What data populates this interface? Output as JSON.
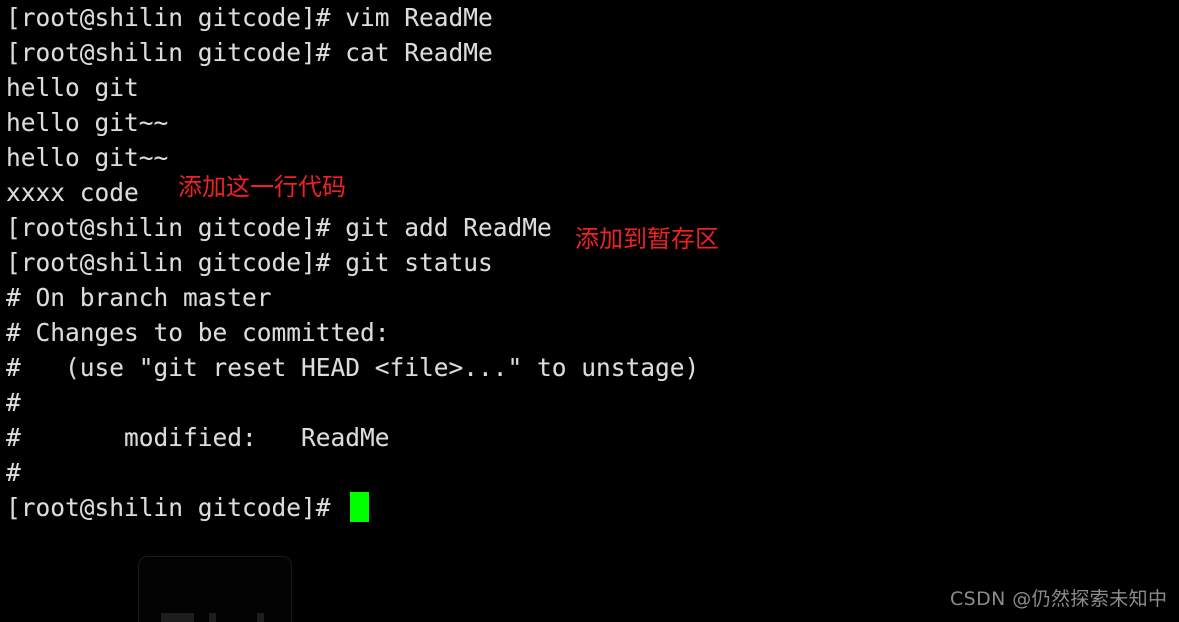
{
  "terminal": {
    "background_color": "#000000",
    "text_color": "#dcdcdc",
    "cursor_color": "#00ff00",
    "lines": [
      {
        "text": "[root@shilin gitcode]# vim ReadMe"
      },
      {
        "text": "[root@shilin gitcode]# cat ReadMe"
      },
      {
        "text": "hello git"
      },
      {
        "text": "hello git~~"
      },
      {
        "text": "hello git~~"
      },
      {
        "text": "xxxx code"
      },
      {
        "text": "[root@shilin gitcode]# git add ReadMe"
      },
      {
        "text": "[root@shilin gitcode]# git status"
      },
      {
        "text": "# On branch master"
      },
      {
        "text": "# Changes to be committed:"
      },
      {
        "text": "#   (use \"git reset HEAD <file>...\" to unstage)"
      },
      {
        "text": "#"
      },
      {
        "text": "#       modified:   ReadMe"
      },
      {
        "text": "#"
      },
      {
        "text": "[root@shilin gitcode]# "
      }
    ]
  },
  "annotations": {
    "color": "#ee2222",
    "items": [
      {
        "text": "添加这一行代码"
      },
      {
        "text": "添加到暂存区"
      }
    ]
  },
  "watermark": {
    "text": "CSDN @仍然探索未知中",
    "color": "#8b8b8b"
  }
}
